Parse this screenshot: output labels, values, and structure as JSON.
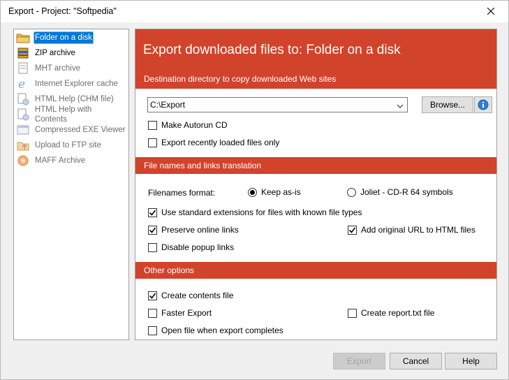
{
  "window": {
    "title": "Export - Project: \"Softpedia\"",
    "close_icon": "close-icon"
  },
  "nav": {
    "items": [
      {
        "label": "Folder on a disk",
        "icon": "folder-icon",
        "selected": true,
        "disabled": false
      },
      {
        "label": "ZIP archive",
        "icon": "zip-archive-icon",
        "selected": false,
        "disabled": false
      },
      {
        "label": "MHT archive",
        "icon": "mht-archive-icon",
        "selected": false,
        "disabled": true
      },
      {
        "label": "Internet Explorer cache",
        "icon": "internet-explorer-icon",
        "selected": false,
        "disabled": true
      },
      {
        "label": "HTML Help (CHM file)",
        "icon": "html-help-icon",
        "selected": false,
        "disabled": true
      },
      {
        "label": "HTML Help with Contents",
        "icon": "html-help-contents-icon",
        "selected": false,
        "disabled": true
      },
      {
        "label": "Compressed EXE Viewer",
        "icon": "exe-viewer-icon",
        "selected": false,
        "disabled": true
      },
      {
        "label": "Upload to FTP site",
        "icon": "ftp-upload-icon",
        "selected": false,
        "disabled": true
      },
      {
        "label": "MAFF Archive",
        "icon": "maff-archive-icon",
        "selected": false,
        "disabled": true
      }
    ]
  },
  "main": {
    "header_title": "Export downloaded files to: Folder on a disk",
    "destination": {
      "section_label": "Destination directory to copy downloaded Web sites",
      "path_value": "C:\\Export",
      "browse_label": "Browse...",
      "make_autorun_label": "Make Autorun CD",
      "make_autorun_checked": false,
      "export_recent_label": "Export recently loaded files only",
      "export_recent_checked": false
    },
    "names": {
      "section_label": "File names and links translation",
      "filenames_format_label": "Filenames format:",
      "keep_as_is_label": "Keep as-is",
      "keep_as_is_selected": true,
      "joliet_label": "Joliet - CD-R 64 symbols",
      "joliet_selected": false,
      "std_ext_label": "Use standard extensions for files with known file types",
      "std_ext_checked": true,
      "preserve_links_label": "Preserve online links",
      "preserve_links_checked": true,
      "add_url_label": "Add original URL to HTML files",
      "add_url_checked": true,
      "disable_popup_label": "Disable popup links",
      "disable_popup_checked": false
    },
    "other": {
      "section_label": "Other options",
      "create_contents_label": "Create contents file",
      "create_contents_checked": true,
      "faster_export_label": "Faster Export",
      "faster_export_checked": false,
      "create_report_label": "Create report.txt file",
      "create_report_checked": false,
      "open_file_label": "Open file when export completes",
      "open_file_checked": false
    }
  },
  "footer": {
    "export_label": "Export",
    "cancel_label": "Cancel",
    "help_label": "Help"
  },
  "colors": {
    "accent": "#d2432b",
    "selection": "#0078d7"
  }
}
